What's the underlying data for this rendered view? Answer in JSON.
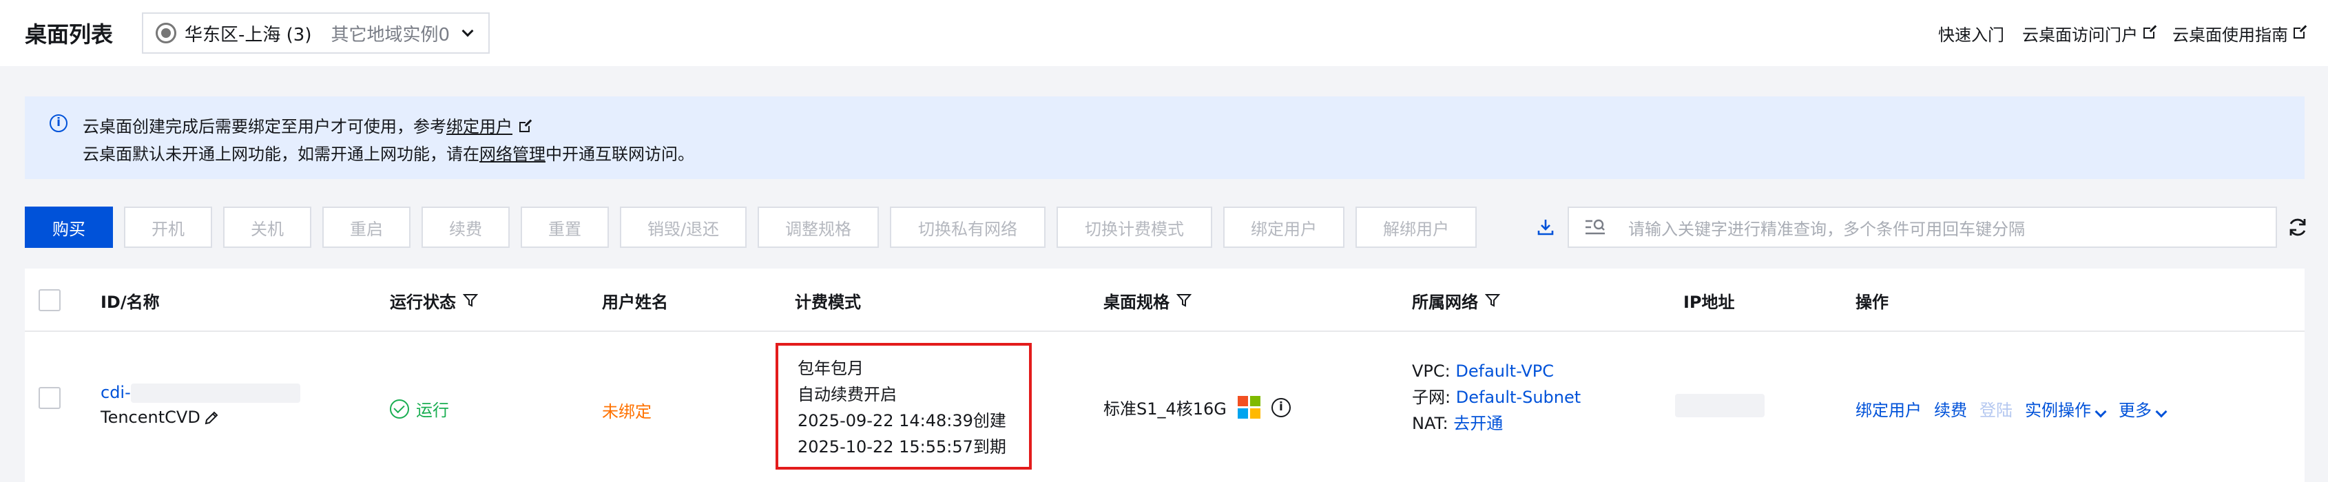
{
  "header": {
    "title": "桌面列表",
    "region": "华东区-上海 (3)",
    "other_regions": "其它地域实例0",
    "links": [
      "快速入门",
      "云桌面访问门户",
      "云桌面使用指南"
    ]
  },
  "notice": {
    "line1_prefix": "云桌面创建完成后需要绑定至用户才可使用，参考",
    "line1_link": "绑定用户",
    "line2_prefix": "云桌面默认未开通上网功能，如需开通上网功能，请在",
    "line2_link": "网络管理",
    "line2_suffix": "中开通互联网访问。"
  },
  "toolbar": {
    "buttons": [
      "购买",
      "开机",
      "关机",
      "重启",
      "续费",
      "重置",
      "销毁/退还",
      "调整规格",
      "切换私有网络",
      "切换计费模式",
      "绑定用户",
      "解绑用户"
    ],
    "search_placeholder": "请输入关键字进行精准查询，多个条件可用回车键分隔"
  },
  "table": {
    "columns": [
      "ID/名称",
      "运行状态",
      "用户姓名",
      "计费模式",
      "桌面规格",
      "所属网络",
      "IP地址",
      "操作"
    ],
    "rows": [
      {
        "id_prefix": "cdi-",
        "name": "TencentCVD",
        "status": "运行",
        "user": "未绑定",
        "billing": [
          "包年包月",
          "自动续费开启",
          "2025-09-22 14:48:39创建",
          "2025-10-22 15:55:57到期"
        ],
        "spec": "标准S1_4核16G",
        "network": {
          "vpc_label": "VPC:",
          "vpc": "Default-VPC",
          "subnet_label": "子网:",
          "subnet": "Default-Subnet",
          "nat_label": "NAT:",
          "nat": "去开通"
        },
        "actions": [
          "绑定用户",
          "续费",
          "登陆",
          "实例操作",
          "更多"
        ]
      }
    ]
  },
  "colors": {
    "primary": "#0052d9",
    "running": "#1aae52",
    "unbound": "#ff7200",
    "highlight_border": "#e31c1c"
  }
}
